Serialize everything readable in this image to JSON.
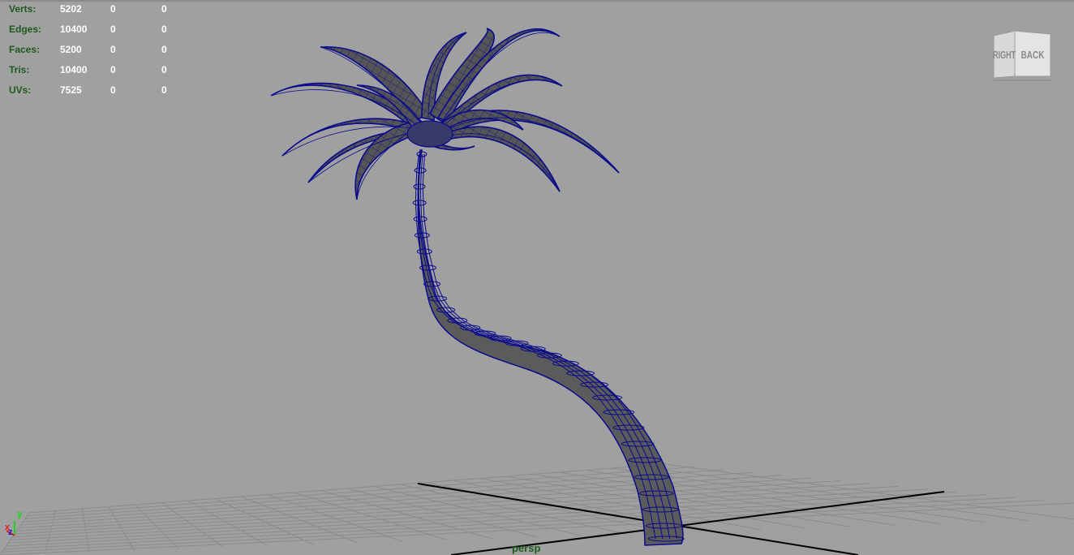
{
  "hud": {
    "rows": [
      {
        "label": "Verts:",
        "v1": "5202",
        "v2": "0",
        "v3": "0"
      },
      {
        "label": "Edges:",
        "v1": "10400",
        "v2": "0",
        "v3": "0"
      },
      {
        "label": "Faces:",
        "v1": "5200",
        "v2": "0",
        "v3": "0"
      },
      {
        "label": "Tris:",
        "v1": "10400",
        "v2": "0",
        "v3": "0"
      },
      {
        "label": "UVs:",
        "v1": "7525",
        "v2": "0",
        "v3": "0"
      }
    ]
  },
  "viewcube": {
    "left_face": "RIGHT",
    "right_face": "BACK"
  },
  "camera": {
    "name": "persp"
  },
  "axis_gizmo": {
    "y": "y",
    "x": "x",
    "z": "z"
  },
  "colors": {
    "background": "#a0a0a0",
    "hud_label": "#1d5a1d",
    "hud_value": "#ffffff",
    "wireframe": "#0a0a8c",
    "mesh_fill": "#5a5a5a",
    "grid": "#8c8c8c",
    "grid_axis": "#000000"
  }
}
